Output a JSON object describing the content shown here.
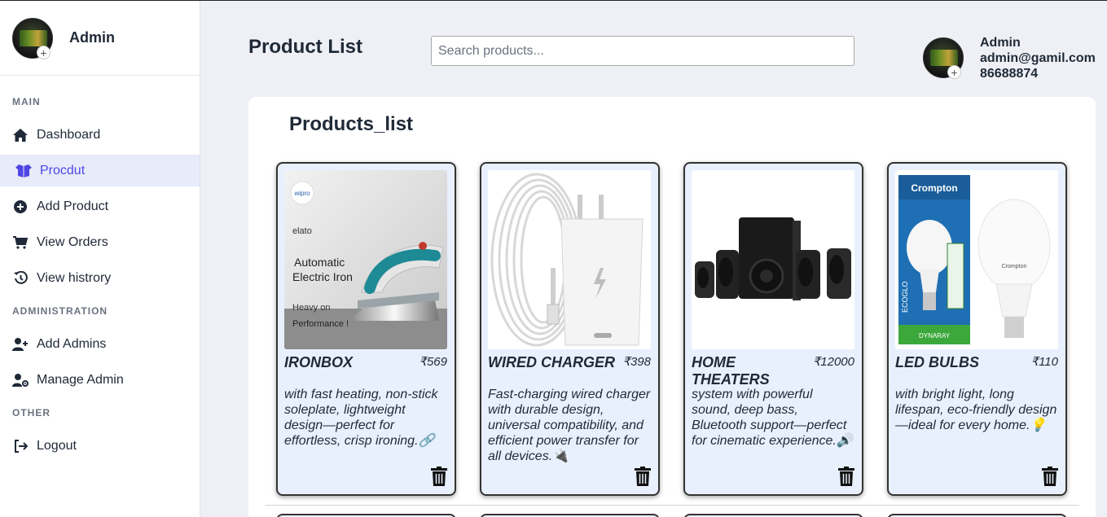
{
  "sidebar": {
    "brand_name": "Admin",
    "sections": {
      "main": "MAIN",
      "administration": "ADMINISTRATION",
      "other": "OTHER"
    },
    "items": {
      "dashboard": "Dashboard",
      "product": "Procdut",
      "add_product": "Add Product",
      "view_orders": "View Orders",
      "view_history": "View histrory",
      "add_admins": "Add Admins",
      "manage_admin": "Manage Admin",
      "logout": "Logout"
    },
    "active_item": "product"
  },
  "header": {
    "title": "Product List",
    "search_placeholder": "Search products...",
    "user": {
      "name": "Admin",
      "email": "admin@gamil.com",
      "phone": "86688874"
    }
  },
  "panel": {
    "title": "Products_list"
  },
  "products": [
    {
      "name": "IRONBOX",
      "price": "₹569",
      "description": "with fast heating, non-stick soleplate, lightweight design—perfect for effortless, crisp ironing.🔗",
      "image": "electric-iron"
    },
    {
      "name": "WIRED CHARGER",
      "price": "₹398",
      "description": "Fast-charging wired charger with durable design, universal compatibility, and efficient power transfer for all devices.🔌",
      "image": "wired-charger"
    },
    {
      "name": "HOME THEATERS",
      "price": "₹12000",
      "description": "system with powerful sound, deep bass, Bluetooth support—perfect for cinematic experience.🔊",
      "image": "home-theater"
    },
    {
      "name": "LED BULBS",
      "price": "₹110",
      "description": "with bright light, long lifespan, eco-friendly design—ideal for every home.💡",
      "image": "led-bulbs"
    }
  ],
  "image_text": {
    "iron_brand": "wipro",
    "iron_sub": "elato",
    "iron_line1": "Automatic",
    "iron_line2": "Electric Iron",
    "iron_tag1": "Heavy on",
    "iron_tag2": "Performance !",
    "bulb_brand": "Crompton",
    "bulb_box_label": "ECOGLO",
    "bulb_box_bottom": "DYNARAY"
  },
  "colors": {
    "accent": "#4f46e5",
    "active_bg": "#e7ebfa",
    "card_bg": "#e9f0fd"
  }
}
